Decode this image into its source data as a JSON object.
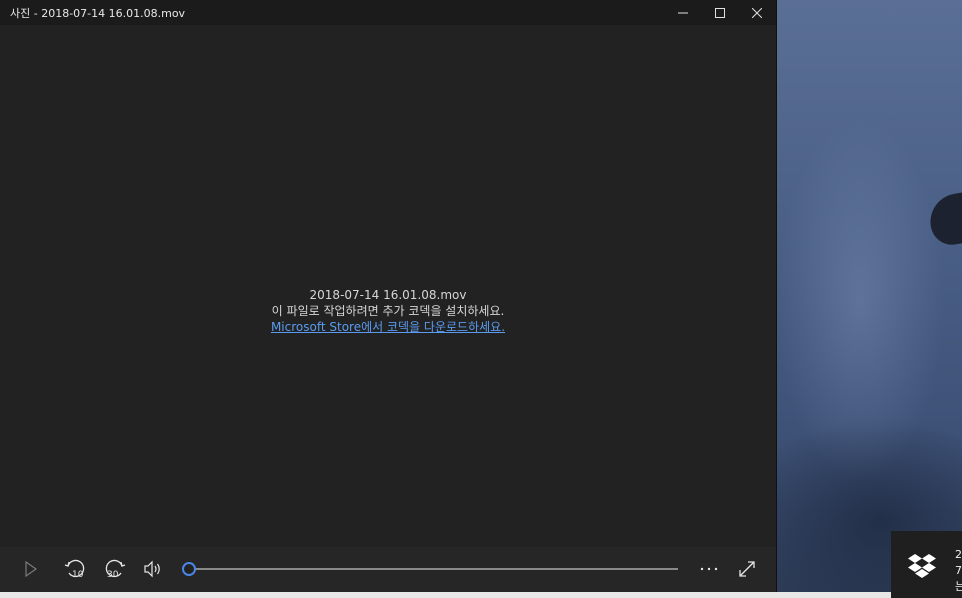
{
  "window": {
    "title": "사진 - 2018-07-14 16.01.08.mov",
    "buttons": {
      "minimize": "minimize-icon",
      "maximize": "maximize-icon",
      "close": "close-icon"
    }
  },
  "message": {
    "filename": "2018-07-14 16.01.08.mov",
    "line2": "이 파일로 작업하려면 추가 코덱을 설치하세요.",
    "link": "Microsoft Store에서 코덱을 다운로드하세요."
  },
  "controls": {
    "play": "play-icon",
    "skip_back": "10",
    "skip_forward": "30",
    "volume": "volume-icon",
    "seek_progress": 0,
    "more": "more-icon",
    "fullscreen": "fullscreen-icon"
  },
  "toast": {
    "icon": "dropbox-icon",
    "lines": [
      "2",
      "7",
      "는"
    ]
  },
  "colors": {
    "accent": "#4a86e8",
    "link": "#5a9bf0",
    "window_bg": "#222222"
  }
}
